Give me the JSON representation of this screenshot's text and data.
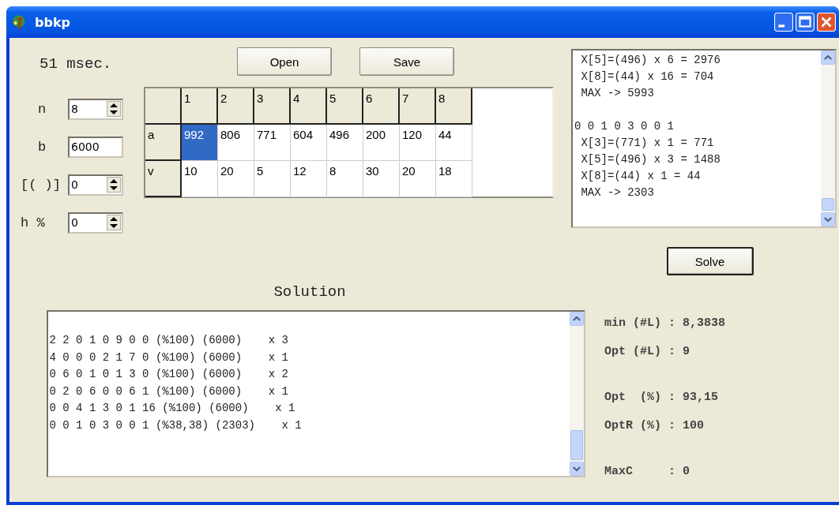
{
  "window": {
    "title": "bbkp"
  },
  "timing": "51 msec.",
  "params": [
    {
      "label": "n",
      "value": "8",
      "kind": "spin"
    },
    {
      "label": "b",
      "value": "6000",
      "kind": "text"
    },
    {
      "label": "[( )]",
      "value": "0",
      "kind": "spin"
    },
    {
      "label": "h %",
      "value": "0",
      "kind": "spin"
    }
  ],
  "buttons": [
    "Open",
    "Save"
  ],
  "table": {
    "columns": [
      "1",
      "2",
      "3",
      "4",
      "5",
      "6",
      "7",
      "8"
    ],
    "rows": [
      {
        "label": "a",
        "cells": [
          {
            "text": "992",
            "selected": true
          },
          {
            "text": "806",
            "selected": false
          },
          {
            "text": "771",
            "selected": false
          },
          {
            "text": "604",
            "selected": false
          },
          {
            "text": "496",
            "selected": false
          },
          {
            "text": "200",
            "selected": false
          },
          {
            "text": "120",
            "selected": false
          },
          {
            "text": "44",
            "selected": false
          }
        ]
      },
      {
        "label": "v",
        "cells": [
          {
            "text": "10",
            "selected": false
          },
          {
            "text": "20",
            "selected": false
          },
          {
            "text": "5",
            "selected": false
          },
          {
            "text": "12",
            "selected": false
          },
          {
            "text": "8",
            "selected": false
          },
          {
            "text": "30",
            "selected": false
          },
          {
            "text": "20",
            "selected": false
          },
          {
            "text": "18",
            "selected": false
          }
        ]
      }
    ]
  },
  "log": {
    "blocks": [
      {
        "lines": [
          " X[5]=(496) x 6 = 2976",
          " X[8]=(44) x 16 = 704",
          " MAX -> 5993"
        ]
      },
      {
        "lines": [
          "0 0 1 0 3 0 0 1",
          " X[3]=(771) x 1 = 771",
          " X[5]=(496) x 3 = 1488",
          " X[8]=(44) x 1 = 44",
          " MAX -> 2303"
        ]
      }
    ]
  },
  "solve_button": "Solve",
  "solution": {
    "title": "Solution",
    "lines": [
      "2 2 0 1 0 9 0 0 (%100) (6000)    x 3",
      "4 0 0 0 2 1 7 0 (%100) (6000)    x 1",
      "0 6 0 1 0 1 3 0 (%100) (6000)    x 2",
      "0 2 0 6 0 0 6 1 (%100) (6000)    x 1",
      "0 0 4 1 3 0 1 16 (%100) (6000)    x 1",
      "0 0 1 0 3 0 0 1 (%38,38) (2303)    x 1"
    ]
  },
  "stats": {
    "groups": [
      {
        "lines": [
          "min (#L) : 8,3838",
          "Opt (#L) : 9"
        ]
      },
      {
        "lines": [
          "Opt  (%) : 93,15",
          "OptR (%) : 100"
        ]
      },
      {
        "lines": [
          "MaxC     : 0"
        ]
      }
    ]
  }
}
